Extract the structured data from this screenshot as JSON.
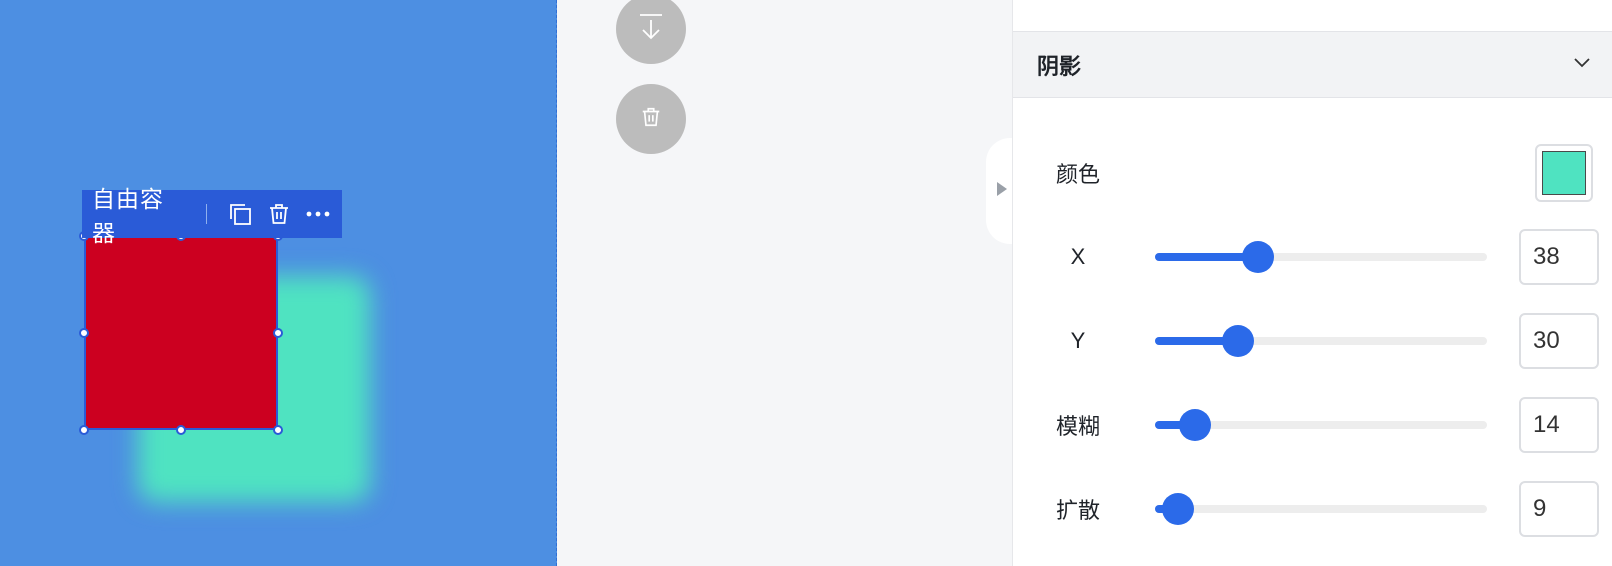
{
  "canvas": {
    "background": "#4d8fe2",
    "shape_color": "#cc0020",
    "shadow_color": "#4fe3c1"
  },
  "toolbar": {
    "label": "自由容器",
    "icons": [
      "copy-icon",
      "trash-icon",
      "more-icon"
    ]
  },
  "floating_buttons": [
    "download-icon",
    "trash-icon"
  ],
  "panel": {
    "section_title": "阴影",
    "collapse_icon": "chevron-down-icon",
    "color_label": "颜色",
    "color_value": "#4fe3c1",
    "sliders": [
      {
        "label": "X",
        "value": "38",
        "position": 0.31
      },
      {
        "label": "Y",
        "value": "30",
        "position": 0.25
      },
      {
        "label": "模糊",
        "value": "14",
        "position": 0.12
      },
      {
        "label": "扩散",
        "value": "9",
        "position": 0.07
      }
    ]
  }
}
